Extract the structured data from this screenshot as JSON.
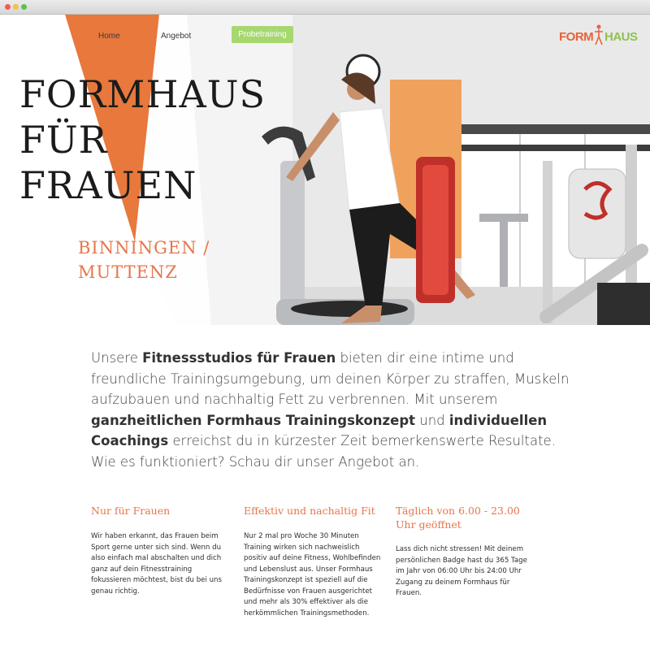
{
  "nav": {
    "home": "Home",
    "angebot": "Angebot",
    "probetraining": "Probetraining"
  },
  "logo": {
    "form": "FORM",
    "haus": "HAUS"
  },
  "hero": {
    "title_lines": [
      "FORMHAUS",
      "FÜR",
      "FRAUEN"
    ],
    "location_lines": [
      "BINNINGEN /",
      "MUTTENZ"
    ]
  },
  "intro": {
    "p1": "Unsere ",
    "b1": "Fitnessstudios für Frauen",
    "p2": " bieten dir eine intime und freundliche Trainingsumgebung, um deinen Körper zu straffen, Muskeln aufzubauen und nachhaltig Fett zu verbrennen. Mit unserem ",
    "b2": "ganzheitlichen Formhaus Trainingskonzept",
    "p3": " und ",
    "b3": "individuellen Coachings",
    "p4": " erreichst du in kürzester Zeit bemerkenswerte Resultate. Wie es funktioniert? Schau dir unser Angebot an."
  },
  "features": [
    {
      "title": "Nur für Frauen",
      "text": "Wir haben erkannt, das Frauen beim Sport gerne unter sich sind. Wenn du also einfach mal abschalten und dich ganz auf dein Fitnesstraining fokussieren möchtest, bist du bei uns genau richtig."
    },
    {
      "title": "Effektiv und nachaltig Fit",
      "text": "Nur 2 mal pro Woche 30 Minuten Training wirken sich nachweislich positiv auf deine Fitness, Wohlbefinden und Lebenslust aus. Unser Formhaus Trainingskonzept ist speziell auf die Bedürfnisse von Frauen ausgerichtet und mehr als 30% effektiver als die herkömmlichen Trainingsmethoden."
    },
    {
      "title": "Täglich von 6.00 - 23.00 Uhr geöffnet",
      "text": "Lass dich nicht stressen! Mit deinem persönlichen Badge hast du 365 Tage im Jahr von 06:00 Uhr bis 24:00 Uhr Zugang zu deinem Formhaus für Frauen."
    }
  ],
  "colors": {
    "accent_orange": "#e8754a",
    "accent_green": "#a6d86f",
    "text_dark": "#1b1b1b"
  },
  "icons": {
    "window_controls": [
      "close-dot",
      "minimize-dot",
      "maximize-dot"
    ],
    "logo_figure": "running-figure-icon"
  }
}
